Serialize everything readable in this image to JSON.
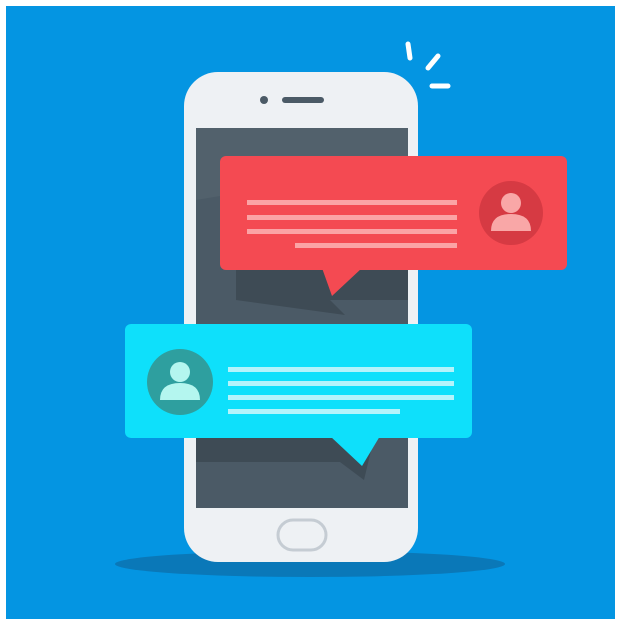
{
  "colors": {
    "background": "#0495e2",
    "phone_body": "#eef1f4",
    "screen": "#4b5a66",
    "screen_fold": "#3e4b55",
    "red_bubble": "#f44a52",
    "red_avatar": "#d63a43",
    "red_avatar_figure": "#f9a7a7",
    "cyan_bubble": "#0ee0fb",
    "cyan_avatar": "#2e9f9f",
    "cyan_avatar_figure": "#b4f6ef",
    "text_lines_red": "#fba3a5",
    "text_lines_cyan": "#b4f4fb",
    "shadow": "#0a78b8",
    "ring_lines": "#ffffff"
  },
  "icons": {
    "phone": "smartphone-icon",
    "red_message": "chat-bubble-icon",
    "cyan_message": "chat-bubble-icon",
    "red_user": "user-avatar-icon",
    "cyan_user": "user-avatar-icon",
    "ring": "notification-ring-icon"
  },
  "messages": [
    {
      "sender": "user-avatar",
      "color": "red",
      "lines": 4
    },
    {
      "sender": "user-avatar",
      "color": "cyan",
      "lines": 4
    }
  ]
}
